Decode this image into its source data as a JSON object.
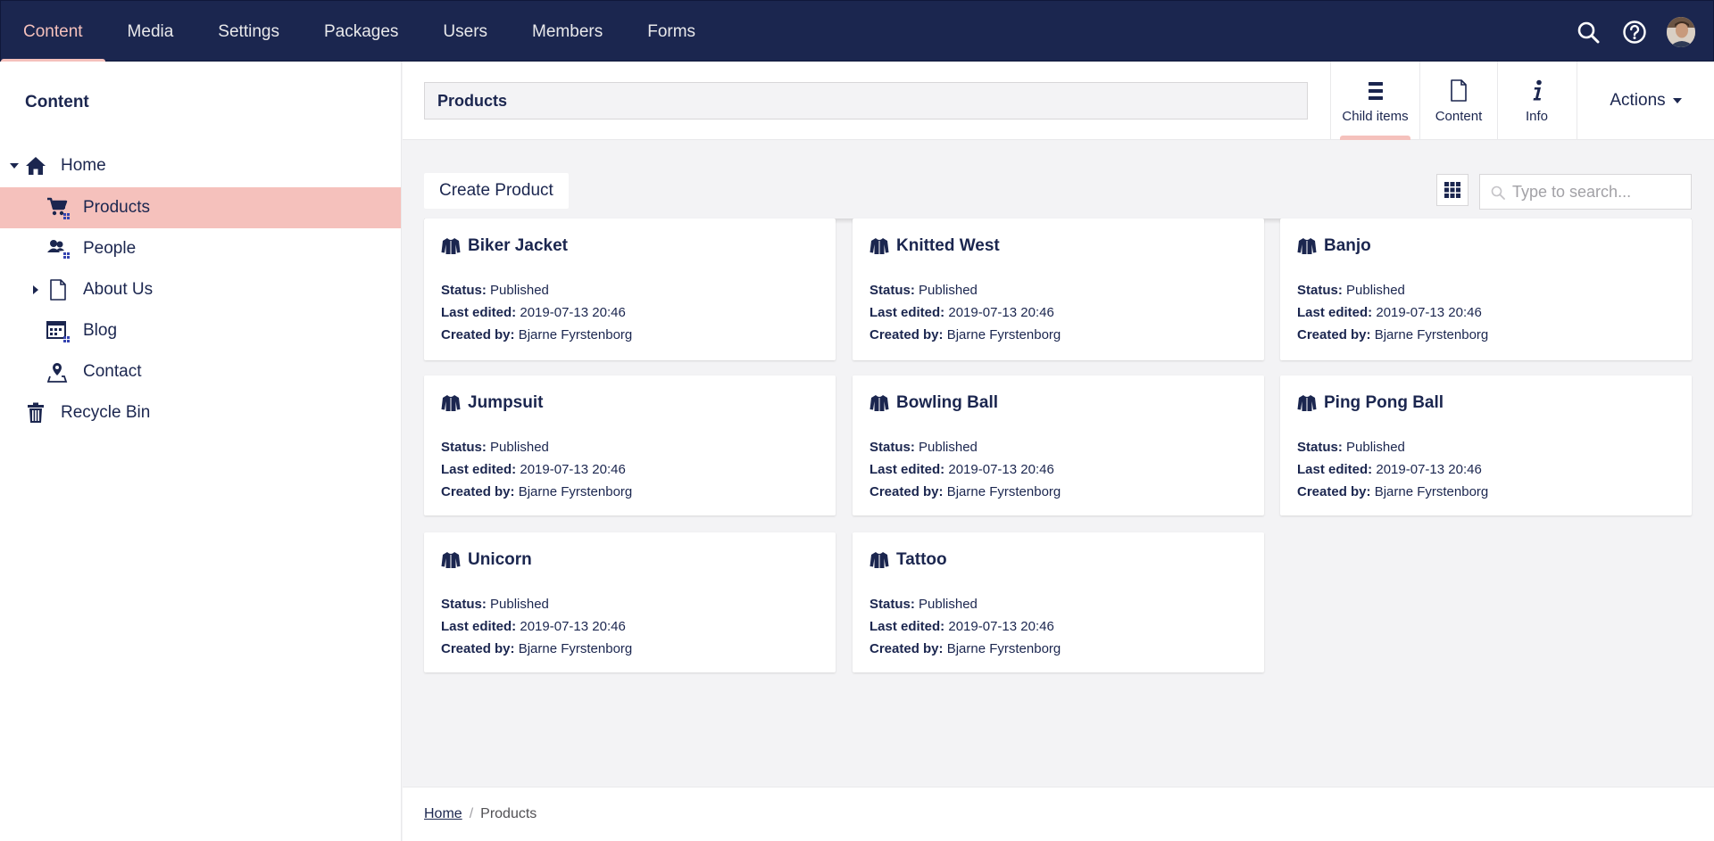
{
  "topnav": {
    "items": [
      {
        "label": "Content",
        "active": true
      },
      {
        "label": "Media"
      },
      {
        "label": "Settings"
      },
      {
        "label": "Packages"
      },
      {
        "label": "Users"
      },
      {
        "label": "Members"
      },
      {
        "label": "Forms"
      }
    ],
    "icons": [
      "search-icon",
      "help-icon",
      "user-avatar"
    ]
  },
  "sidebar": {
    "title": "Content",
    "tree": [
      {
        "label": "Home",
        "icon": "home-icon",
        "expanded": true
      },
      {
        "label": "Products",
        "icon": "shopping-cart-icon",
        "selected": true
      },
      {
        "label": "People",
        "icon": "users-icon"
      },
      {
        "label": "About Us",
        "icon": "document-icon",
        "collapsed": true
      },
      {
        "label": "Blog",
        "icon": "calendar-icon"
      },
      {
        "label": "Contact",
        "icon": "map-pin-icon"
      },
      {
        "label": "Recycle Bin",
        "icon": "trash-icon"
      }
    ]
  },
  "header": {
    "node_name": "Products",
    "tabs": [
      {
        "label": "Child items",
        "icon": "list-icon",
        "active": true
      },
      {
        "label": "Content",
        "icon": "document-icon"
      },
      {
        "label": "Info",
        "icon": "info-icon"
      }
    ],
    "actions_label": "Actions"
  },
  "toolbar": {
    "create_label": "Create Product",
    "layout_icon": "grid-icon",
    "search_placeholder": "Type to search..."
  },
  "meta_labels": {
    "status": "Status:",
    "last_edited": "Last edited:",
    "created_by": "Created by:"
  },
  "cards": [
    {
      "name": "Biker Jacket",
      "status": "Published",
      "last_edited": "2019-07-13 20:46",
      "created_by": "Bjarne Fyrstenborg"
    },
    {
      "name": "Knitted West",
      "status": "Published",
      "last_edited": "2019-07-13 20:46",
      "created_by": "Bjarne Fyrstenborg"
    },
    {
      "name": "Banjo",
      "status": "Published",
      "last_edited": "2019-07-13 20:46",
      "created_by": "Bjarne Fyrstenborg"
    },
    {
      "name": "Jumpsuit",
      "status": "Published",
      "last_edited": "2019-07-13 20:46",
      "created_by": "Bjarne Fyrstenborg"
    },
    {
      "name": "Bowling Ball",
      "status": "Published",
      "last_edited": "2019-07-13 20:46",
      "created_by": "Bjarne Fyrstenborg"
    },
    {
      "name": "Ping Pong Ball",
      "status": "Published",
      "last_edited": "2019-07-13 20:46",
      "created_by": "Bjarne Fyrstenborg"
    },
    {
      "name": "Unicorn",
      "status": "Published",
      "last_edited": "2019-07-13 20:46",
      "created_by": "Bjarne Fyrstenborg"
    },
    {
      "name": "Tattoo",
      "status": "Published",
      "last_edited": "2019-07-13 20:46",
      "created_by": "Bjarne Fyrstenborg"
    }
  ],
  "breadcrumb": [
    {
      "label": "Home",
      "link": true
    },
    {
      "label": "Products"
    }
  ],
  "breadcrumb_separator": "/",
  "colors": {
    "topbar": "#1b264f",
    "accent": "#f5c1bc",
    "text": "#1b264f",
    "background": "#f3f3f5"
  }
}
